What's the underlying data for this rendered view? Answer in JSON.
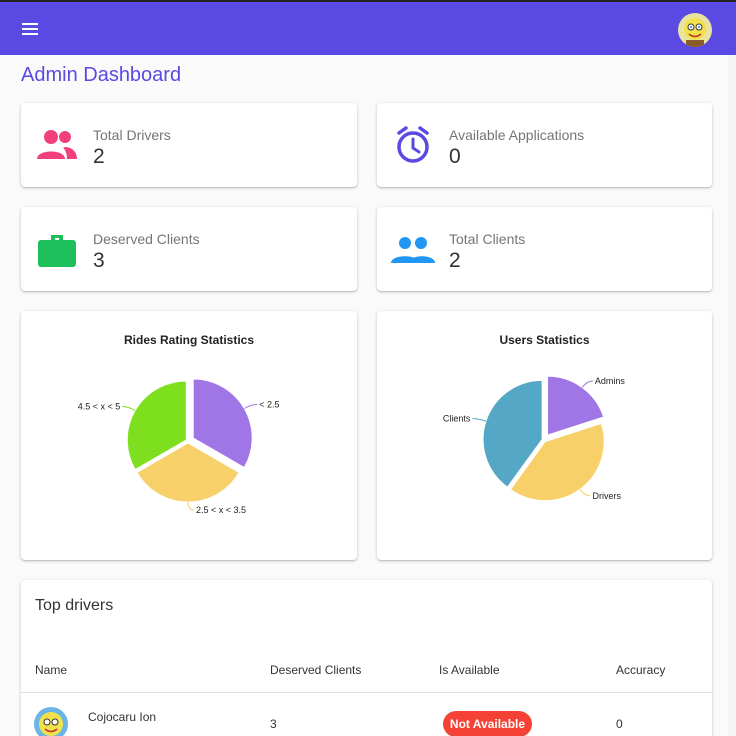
{
  "header": {
    "menu_icon": "menu-icon",
    "avatar_icon": "user-avatar"
  },
  "page": {
    "title": "Admin Dashboard"
  },
  "stats": [
    {
      "label": "Total Drivers",
      "value": "2",
      "icon": "people-icon",
      "color": "#f2407d"
    },
    {
      "label": "Available Applications",
      "value": "0",
      "icon": "alarm-clock-icon",
      "color": "#5a49e3"
    },
    {
      "label": "Deserved Clients",
      "value": "3",
      "icon": "briefcase-icon",
      "color": "#1ec05b"
    },
    {
      "label": "Total Clients",
      "value": "2",
      "icon": "group-icon",
      "color": "#2196f3"
    }
  ],
  "chart_data": [
    {
      "type": "pie",
      "title": "Rides Rating Statistics",
      "categories": [
        "< 2.5",
        "2.5 < x < 3.5",
        "4.5 < x < 5"
      ],
      "values": [
        1,
        1,
        1
      ],
      "colors": [
        "#a076e6",
        "#f7d06a",
        "#7ddf1e"
      ]
    },
    {
      "type": "pie",
      "title": "Users Statistics",
      "categories": [
        "Admins",
        "Drivers",
        "Clients"
      ],
      "values": [
        1,
        2,
        2
      ],
      "colors": [
        "#a076e6",
        "#f7d06a",
        "#55a7c6"
      ]
    }
  ],
  "top_drivers": {
    "title": "Top drivers",
    "columns": [
      "Name",
      "Deserved Clients",
      "Is Available",
      "Accuracy"
    ],
    "rows": [
      {
        "name": "Cojocaru Ion",
        "deserved_clients": "3",
        "availability": "Not Available",
        "accuracy": "0"
      }
    ]
  },
  "colors": {
    "accent": "#5a49e3",
    "danger": "#f44336"
  }
}
